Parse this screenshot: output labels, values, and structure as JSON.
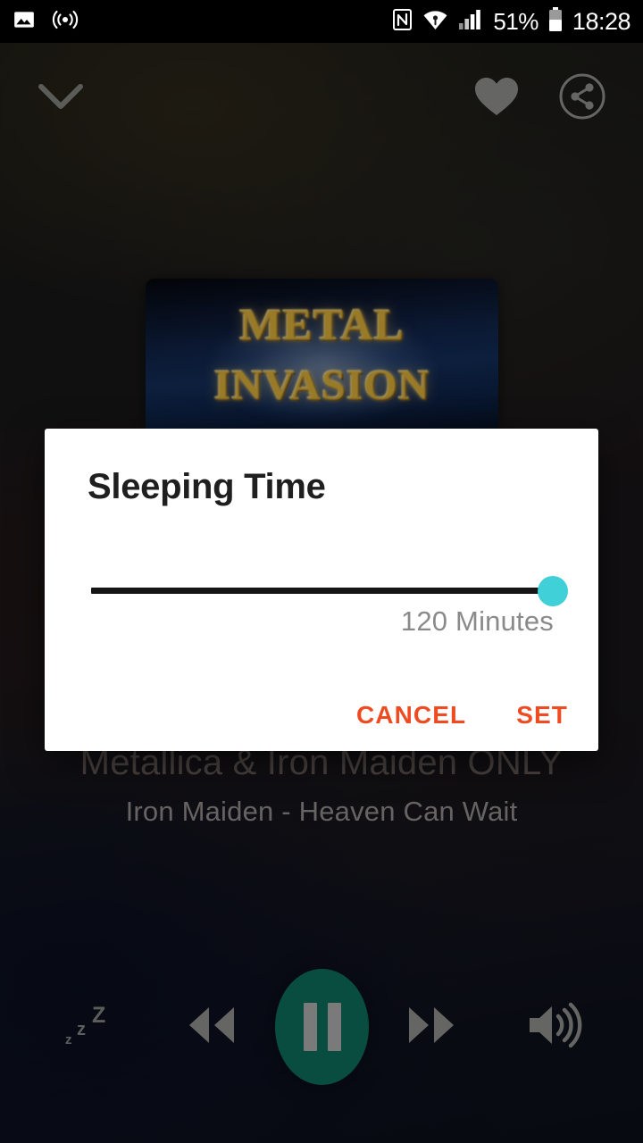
{
  "status_bar": {
    "left_icons": [
      "image-icon",
      "cast-icon"
    ],
    "right_icons": [
      "nfc-icon",
      "wifi-icon",
      "signal-icon",
      "battery-icon"
    ],
    "battery_percent": "51%",
    "time": "18:28"
  },
  "top_nav": {
    "collapse_label": "chevron-down-icon",
    "favorite_label": "heart-icon",
    "share_label": "share-icon"
  },
  "album_art": {
    "line1": "METAL",
    "line2": "INVASION"
  },
  "now_playing": {
    "station": "Metallica & Iron Maiden ONLY",
    "track": "Iron Maiden - Heaven Can Wait"
  },
  "player_controls": {
    "sleep": "sleep-timer-icon",
    "rewind": "rewind-icon",
    "play_pause": "pause-icon",
    "forward": "fast-forward-icon",
    "volume": "volume-icon",
    "play_button_color": "#0d7562"
  },
  "dialog": {
    "title": "Sleeping Time",
    "slider_value_label": "120 Minutes",
    "slider_minutes": 120,
    "slider_percent": 100,
    "thumb_color": "#3fd0d8",
    "cancel_label": "CANCEL",
    "set_label": "SET",
    "action_color": "#ef4b23"
  }
}
